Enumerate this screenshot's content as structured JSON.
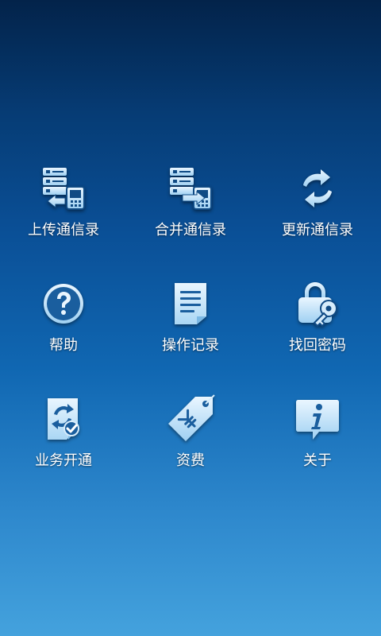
{
  "colors": {
    "icon_light": "#d9eefc",
    "icon_dark": "#0f4a84",
    "label_text": "#ffffff"
  },
  "grid": {
    "items": [
      {
        "label": "上传通信录",
        "icon": "upload-contacts-icon"
      },
      {
        "label": "合并通信录",
        "icon": "merge-contacts-icon"
      },
      {
        "label": "更新通信录",
        "icon": "refresh-icon"
      },
      {
        "label": "帮助",
        "icon": "help-icon"
      },
      {
        "label": "操作记录",
        "icon": "document-icon"
      },
      {
        "label": "找回密码",
        "icon": "lock-key-icon"
      },
      {
        "label": "业务开通",
        "icon": "service-activation-icon"
      },
      {
        "label": "资费",
        "icon": "price-tag-icon"
      },
      {
        "label": "关于",
        "icon": "info-icon"
      }
    ]
  }
}
